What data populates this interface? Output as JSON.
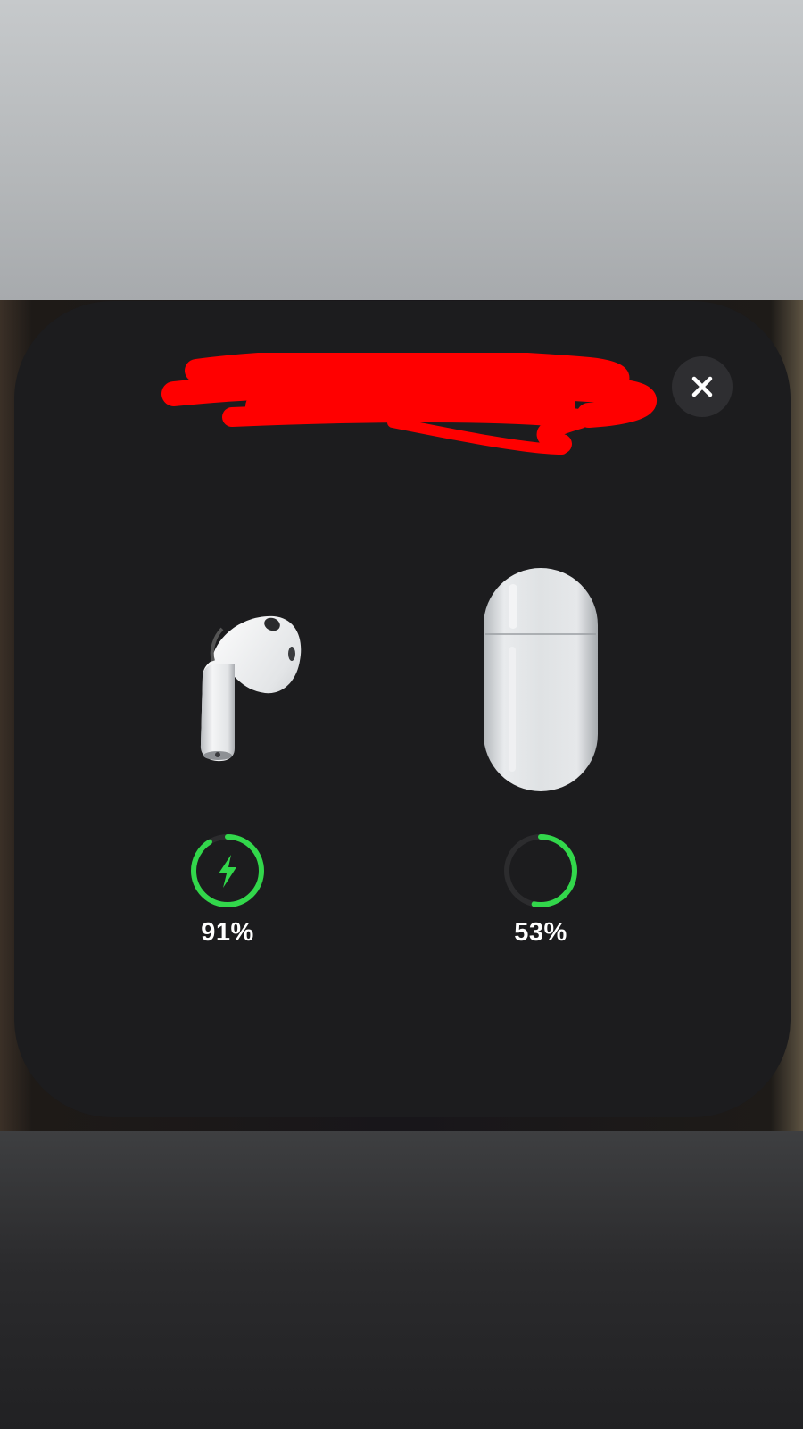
{
  "popup": {
    "close_icon": "close-x-icon",
    "left_device": {
      "icon": "airpod-earbud-icon",
      "battery_percent": 91,
      "battery_label": "91%",
      "charging": true,
      "charging_icon": "lightning-bolt-icon"
    },
    "right_device": {
      "icon": "airpods-case-icon",
      "battery_percent": 53,
      "battery_label": "53%",
      "charging": false
    }
  },
  "colors": {
    "card_background": "#1c1c1e",
    "battery_green": "#32d74b",
    "ring_track": "#2c2c2e",
    "close_button": "#2e2e31",
    "redaction_red": "#ff0000"
  }
}
